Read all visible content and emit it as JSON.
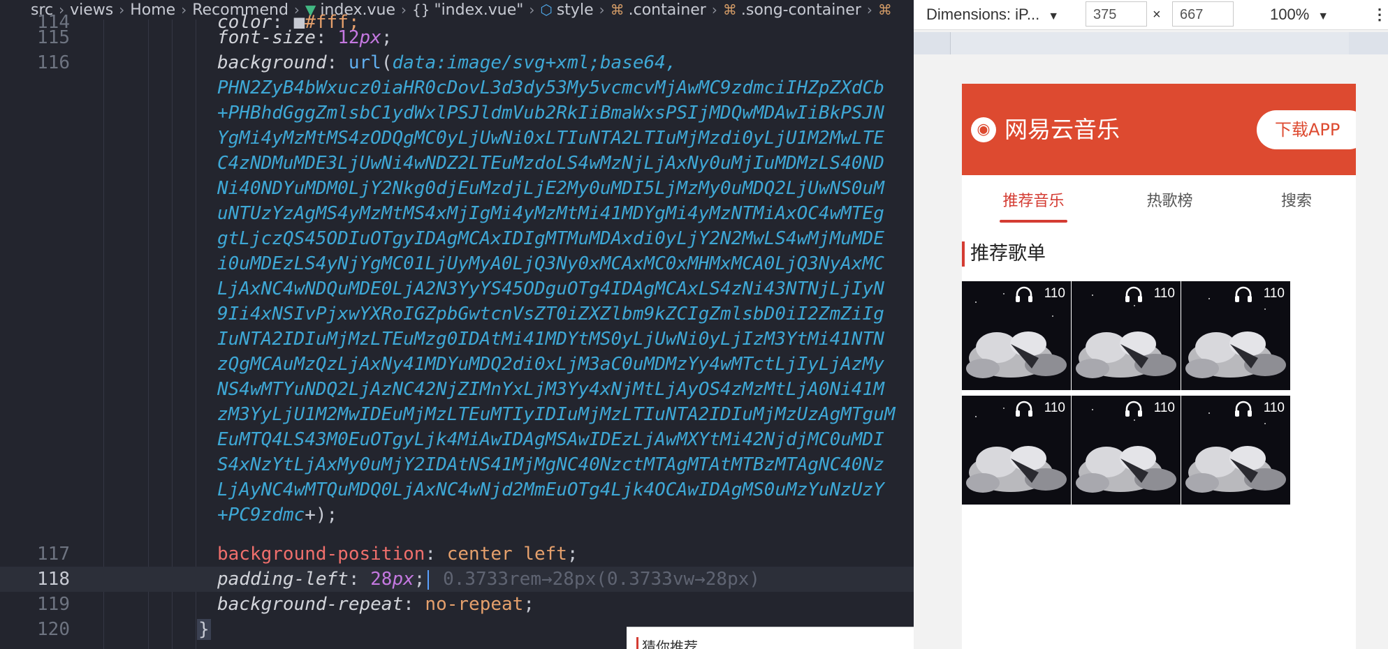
{
  "breadcrumb": {
    "items": [
      "src",
      "views",
      "Home",
      "Recommend",
      "index.vue",
      "\"index.vue\"",
      "style",
      ".container",
      ".song-container"
    ]
  },
  "editor": {
    "line_numbers": [
      "114",
      "115",
      "116",
      "117",
      "118",
      "119",
      "120"
    ],
    "line114": {
      "prop": "color",
      "value": "#fff;"
    },
    "line115": {
      "prop": "font-size",
      "num": "12",
      "unit": "px",
      "end": ";"
    },
    "line116": {
      "prop": "background",
      "fn": "url",
      "open": "(",
      "value": "data:image/svg+xml;base64,"
    },
    "base64_lines": [
      "PHN2ZyB4bWxucz0iaHR0cDovL3d3dy53My5vcmcvMjAwMC9zdmciIHZpZXdCb",
      "+PHBhdGggZmlsbC1ydWxlPSJldmVub2RkIiBmaWxsPSIjMDQwMDAwIiBkPSJN",
      "YgMi4yMzMtMS4zODQgMC0yLjUwNi0xLTIuNTA2LTIuMjMzdi0yLjU1M2MwLTE",
      "C4zNDMuMDE3LjUwNi4wNDZ2LTEuMzdoLS4wMzNjLjAxNy0uMjIuMDMzLS40ND",
      "Ni40NDYuMDM0LjY2Nkg0djEuMzdjLjE2My0uMDI5LjMzMy0uMDQ2LjUwNS0uM",
      "uNTUzYzAgMS4yMzMtMS4xMjIgMi4yMzMtMi41MDYgMi4yMzNTMiAxOC4wMTEg",
      "gtLjczQS45ODIuOTgyIDAgMCAxIDIgMTMuMDAxdi0yLjY2N2MwLS4wMjMuMDE",
      "i0uMDEzLS4yNjYgMC01LjUyMyA0LjQ3Ny0xMCAxMC0xMHMxMCA0LjQ3NyAxMC",
      "LjAxNC4wNDQuMDE0LjA2N3YyYS45ODguOTg4IDAgMCAxLS4zNi43NTNjLjIyN",
      "9Ii4xNSIvPjxwYXRoIGZpbGwtcnVsZT0iZXZlbm9kZCIgZmlsbD0iI2ZmZiIg",
      "IuNTA2IDIuMjMzLTEuMzg0IDAtMi41MDYtMS0yLjUwNi0yLjIzM3YtMi41NTN",
      "zQgMCAuMzQzLjAxNy41MDYuMDQ2di0xLjM3aC0uMDMzYy4wMTctLjIyLjAzMy",
      "NS4wMTYuNDQ2LjAzNC42NjZIMnYxLjM3Yy4xNjMtLjAyOS4zMzMtLjA0Ni41M",
      "zM3YyLjU1M2MwIDEuMjMzLTEuMTIyIDIuMjMzLTIuNTA2IDIuMjMzUzAgMTguM",
      "EuMTQ4LS43M0EuOTgyLjk4MiAwIDAgMSAwIDEzLjAwMXYtMi42NjdjMC0uMDI",
      "S4xNzYtLjAxMy0uMjY2IDAtNS41MjMgNC40NzctMTAgMTAtMTBzMTAgNC40Nz",
      "LjAyNC4wMTQuMDQ0LjAxNC4wNjd2MmEuOTg4Ljk4OCAwIDAgMS0uMzYuNzUzY"
    ],
    "base64_end": "+PC9zdmc",
    "base64_close": "+);",
    "line117": {
      "prop": "background-position",
      "value": "center left",
      "end": ";"
    },
    "line118": {
      "prop": "padding-left",
      "num": "28",
      "unit": "px",
      "end": ";",
      "hint": "0.3733rem→28px(0.3733vw→28px)"
    },
    "line119": {
      "prop": "background-repeat",
      "value": "no-repeat",
      "end": ";"
    },
    "line120": {
      "brace": "}"
    },
    "peek_text": "猜你推荐"
  },
  "devtools": {
    "device_label": "Dimensions: iP...",
    "width": "375",
    "times": "×",
    "height": "667",
    "zoom": "100%",
    "menu_glyph": "⋮"
  },
  "app": {
    "brand_color": "#dd4a30",
    "accent_color": "#d43c33",
    "title": "网易云音乐",
    "download_label": "下载APP",
    "tabs": [
      "推荐音乐",
      "热歌榜",
      "搜索"
    ],
    "active_tab": 0,
    "section_title": "推荐歌单",
    "playlists": [
      {
        "count": "110",
        "icon": "headphones-icon"
      },
      {
        "count": "110",
        "icon": "headphones-icon"
      },
      {
        "count": "110",
        "icon": "headphones-icon"
      },
      {
        "count": "110",
        "icon": "headphones-icon"
      },
      {
        "count": "110",
        "icon": "headphones-icon"
      },
      {
        "count": "110",
        "icon": "headphones-icon"
      }
    ]
  }
}
